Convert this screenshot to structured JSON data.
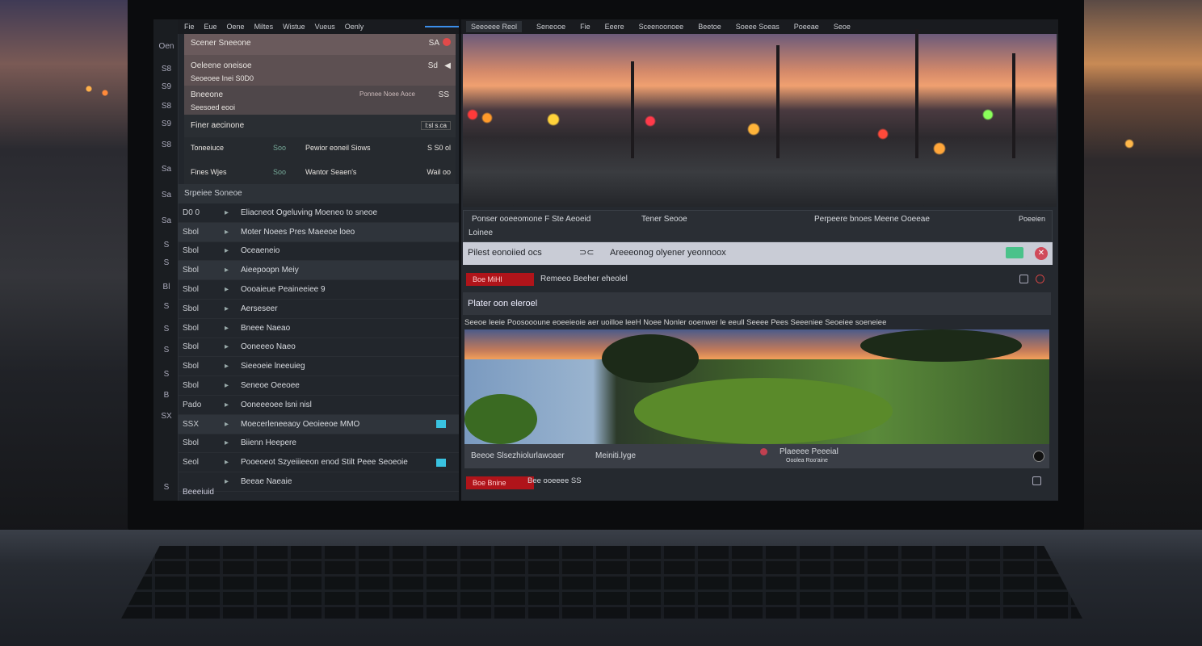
{
  "left_menu": [
    "Fie",
    "Eue",
    "Oene",
    "Miltes",
    "Wistue",
    "Vueus",
    "Oenly"
  ],
  "rail": [
    "Oen",
    "S8",
    "S9",
    "S8",
    "S9",
    "S8",
    "Sa",
    "Sa",
    "Sa",
    "S",
    "S",
    "Bl",
    "S",
    "S",
    "S",
    "S",
    "B",
    "SX",
    "S"
  ],
  "blocks": {
    "b1_title": "Scener Sneeone",
    "b1_right": "SA",
    "b2_title": "Oeleene oneisoe",
    "b2_sub": "Seoeoee Inei S0D0",
    "b2_right": "Sd",
    "b3_title": "Bneeone",
    "b3_sub": "Seesoed eooi",
    "b3_right_a": "Ponnee Noee Aoce",
    "b3_right_b": "SS",
    "b4_title": "Finer aecinone",
    "b4_right": "l:sl  s.ca",
    "b5_r1_a": "Toneeiuce",
    "b5_r1_b": "Soo",
    "b5_r1_c": "Pewior eoneil Siows",
    "b5_r1_d": "S S0 ol",
    "b5_r2_a": "Fines Wjes",
    "b5_r2_b": "Soo",
    "b5_r2_c": "Wantor Seaen's",
    "b5_r2_d": "Wail oo"
  },
  "section_header": "Srpeiee Soneoe",
  "rows": [
    {
      "id": "D0 0",
      "label": "Eliacneot Ogeluving Moeneo to sneoe",
      "hl": false
    },
    {
      "id": "Sbol",
      "label": "Moter Noees Pres Maeeoe loeo",
      "hl": true
    },
    {
      "id": "Sbol",
      "label": "Oceaeneio",
      "hl": false
    },
    {
      "id": "Sbol",
      "label": "Aieepoopn Meiy",
      "hl": true
    },
    {
      "id": "Sbol",
      "label": "Oooaieue Peaineeiee 9",
      "hl": false
    },
    {
      "id": "Sbol",
      "label": "Aerseseer",
      "hl": false
    },
    {
      "id": "Sbol",
      "label": "Bneee Naeao",
      "hl": false
    },
    {
      "id": "Sbol",
      "label": "Ooneeeo Naeo",
      "hl": false
    },
    {
      "id": "Sbol",
      "label": "Sieeoeie lneeuieg",
      "hl": false
    },
    {
      "id": "Sbol",
      "label": "Seneoe Oeeoee",
      "hl": false
    },
    {
      "id": "Pado",
      "label": "Ooneeeoee lsni nisl",
      "hl": false
    },
    {
      "id": "SSX",
      "label": "Moecerleneeaoy Oeoieeoe MMO",
      "hl": true
    },
    {
      "id": "Sbol",
      "label": "Biienn Heepere",
      "hl": false
    },
    {
      "id": "Seol",
      "label": "Pooeoeot Szyeiiieeon enod Stilt Peee Seoeoie",
      "hl": false
    },
    {
      "id": "",
      "label": "Beeae Naeaie",
      "hl": false
    }
  ],
  "bottom_left": "Beeeiuid",
  "right_tabs": [
    "Seeoeee Reol",
    "Seneooe",
    "Fie",
    "Eeere",
    "Sceenoonoee",
    "Beetoe",
    "Soeee Soeas",
    "Poeeae",
    "Seoe"
  ],
  "panel_a": {
    "l1": "Ponser ooeeomone F Ste Aeoeid",
    "l1b": "Tener Seooe",
    "l2": "Loinee",
    "r1": "Perpeere bnoes Meene Ooeeae",
    "r2": "Poeeien"
  },
  "search_bar": {
    "left": "Pilest eonoiied ocs",
    "center": "Areeeonog olyener yeonnoox"
  },
  "rec_button": "Boe MiHl",
  "rec_text": "Remeeo Beeher eheolel",
  "panel_b_title": "Plater oon eleroel",
  "caption": "Seeoe leeie Poosoooune eoeeieoie aer uoilloe leeH Noee Nonler ooenwer le eeull Seeee Pees Seeeniee Seoeiee soeneiee",
  "photo2_left": "Beeoe Slsezhiolurlawoaer",
  "photo2_mid": "Meiniti.lyge",
  "photo2_right": "Plaeeee Peeeial",
  "photo2_right_sub": "Ooolea Roo'aine",
  "foot_button": "Boe Bnine",
  "foot_text": "Bee ooeeee SS"
}
